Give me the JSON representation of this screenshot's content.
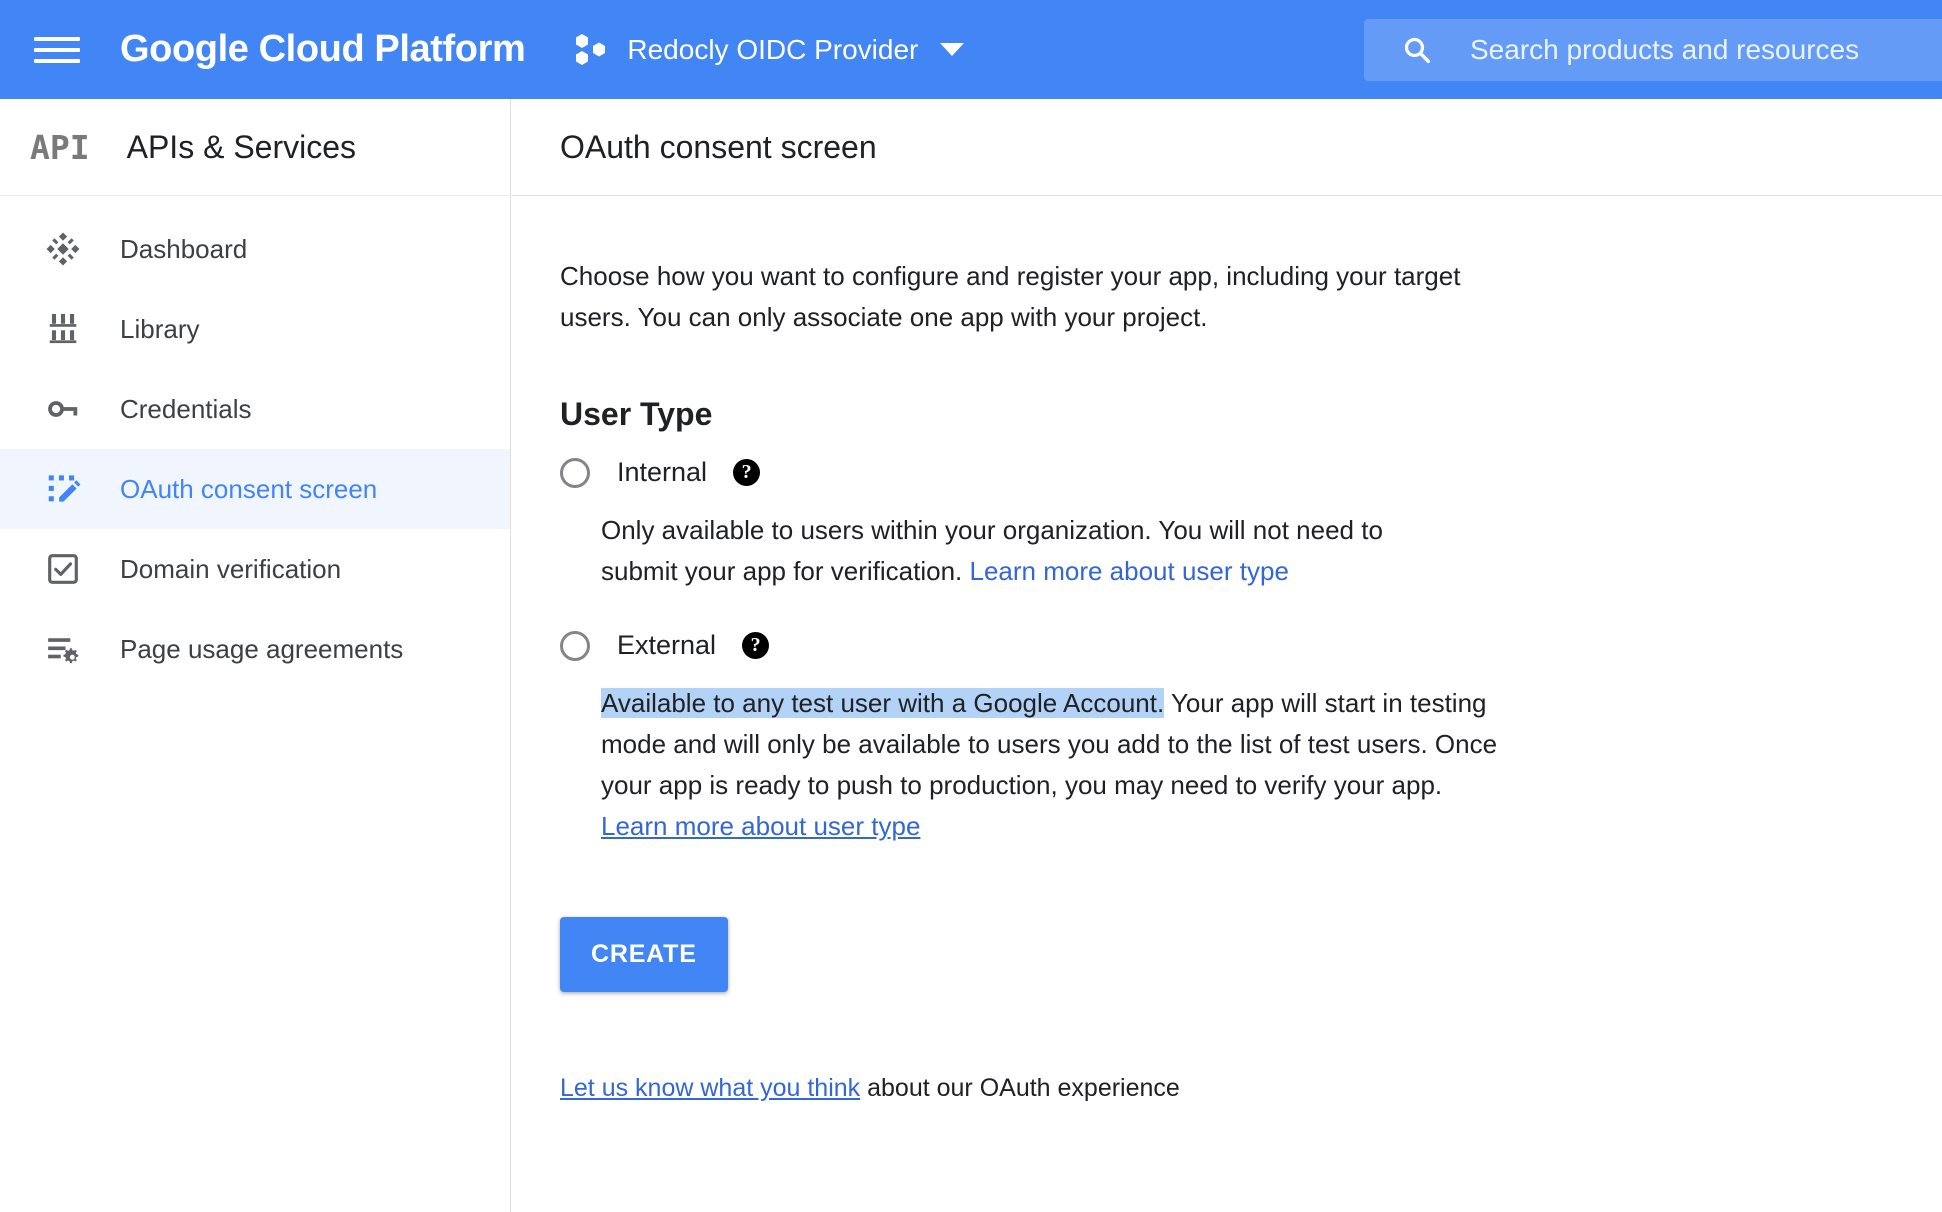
{
  "header": {
    "menu_icon": "hamburger-menu-icon",
    "brand": "Google Cloud Platform",
    "project_icon": "project-hexagons-icon",
    "project_name": "Redocly OIDC Provider",
    "project_dropdown_icon": "chevron-down-icon",
    "search_icon": "search-icon",
    "search_placeholder": "Search products and resources",
    "bar_color": "#4285f4"
  },
  "sidebar": {
    "logo_text": "API",
    "title": "APIs & Services",
    "items": [
      {
        "label": "Dashboard",
        "icon": "dashboard-diamond-icon",
        "active": false
      },
      {
        "label": "Library",
        "icon": "library-bookshelf-icon",
        "active": false
      },
      {
        "label": "Credentials",
        "icon": "key-icon",
        "active": false
      },
      {
        "label": "OAuth consent screen",
        "icon": "consent-screen-edit-icon",
        "active": true
      },
      {
        "label": "Domain verification",
        "icon": "checkbox-verified-icon",
        "active": false
      },
      {
        "label": "Page usage agreements",
        "icon": "list-gear-icon",
        "active": false
      }
    ],
    "active_color": "#4285f4",
    "active_bg": "#f1f5fe"
  },
  "main": {
    "page_title": "OAuth consent screen",
    "intro": "Choose how you want to configure and register your app, including your target users. You can only associate one app with your project.",
    "section_heading": "User Type",
    "options": [
      {
        "label": "Internal",
        "help_icon": "help-question-icon",
        "help_glyph": "?",
        "selected": false,
        "desc_before": "Only available to users within your organization. You will not need to submit your app for verification. ",
        "link_text": "Learn more about user type",
        "link_underlined": false,
        "desc_after": ""
      },
      {
        "label": "External",
        "help_icon": "help-question-icon",
        "help_glyph": "?",
        "selected": false,
        "highlighted_text": "Available to any test user with a Google Account.",
        "desc_before": " Your app will start in testing mode and will only be available to users you add to the list of test users. Once your app is ready to push to production, you may need to verify your app. ",
        "link_text": "Learn more about user type",
        "link_underlined": true,
        "desc_after": ""
      }
    ],
    "create_button": "CREATE",
    "feedback_link": "Let us know what you think",
    "feedback_rest": " about our OAuth experience",
    "selection_highlight_color": "#b3d2f7",
    "link_color": "#3367d6"
  }
}
